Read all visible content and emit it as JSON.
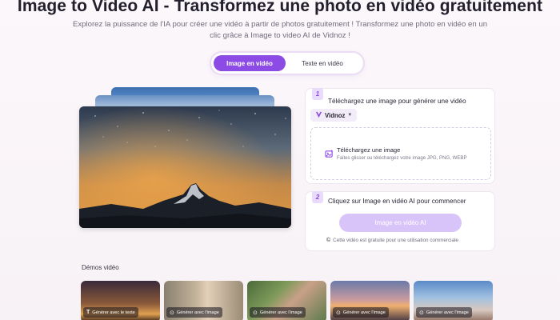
{
  "header": {
    "title": "Image to Video AI - Transformez une photo en vidéo gratuitement",
    "subtitle": "Explorez la puissance de l'IA pour créer une vidéo à partir de photos gratuitement ! Transformez une photo en vidéo en un clic grâce à Image to video AI de Vidnoz !"
  },
  "tabs": [
    {
      "label": "Image en vidéo",
      "active": true
    },
    {
      "label": "Texte en vidéo",
      "active": false
    }
  ],
  "step1": {
    "number": "1",
    "text": "Téléchargez une image pour générer une vidéo",
    "brand": "Vidnoz",
    "upload_title": "Téléchargez une image",
    "upload_hint": "Faites glisser ou téléchargez votre image JPG, PNG, WEBP"
  },
  "step2": {
    "number": "2",
    "text": "Cliquez sur Image en vidéo AI pour commencer",
    "button": "Image en vidéo AI",
    "note": "Cette vidéo est gratuite pour une utilisation commerciale"
  },
  "demos": {
    "label": "Démos vidéo",
    "items": [
      {
        "caption": "Générer avec le texte",
        "icon": "text-icon"
      },
      {
        "caption": "Générer avec l'image",
        "icon": "image-icon"
      },
      {
        "caption": "Générer avec l'image",
        "icon": "image-icon"
      },
      {
        "caption": "Générer avec l'image",
        "icon": "image-icon"
      },
      {
        "caption": "Générer avec l'image",
        "icon": "image-icon"
      }
    ]
  },
  "colors": {
    "accent": "#8d4be6",
    "button_disabled": "#d8c4f8"
  }
}
